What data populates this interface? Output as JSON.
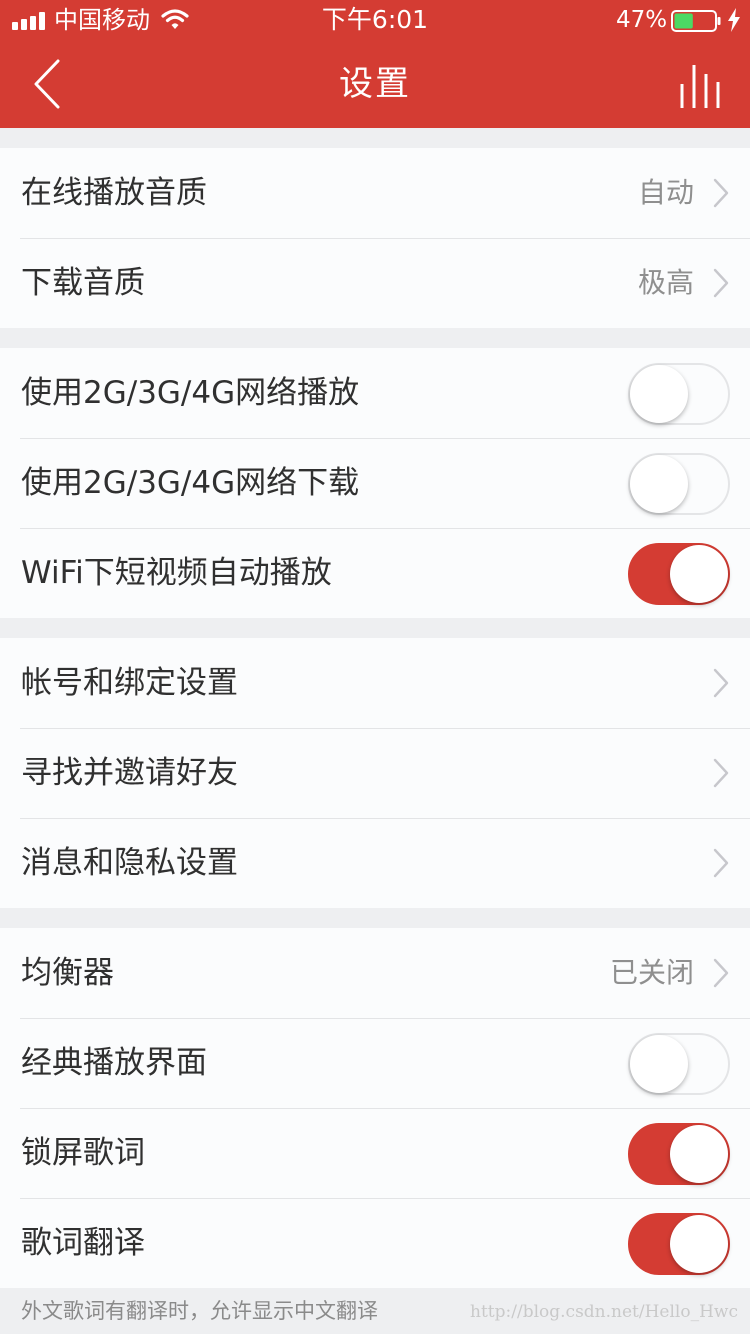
{
  "status_bar": {
    "carrier": "中国移动",
    "time": "下午6:01",
    "battery_percent": "47%",
    "battery_level": 0.47,
    "signal_bars": 4,
    "icons": [
      "signal-icon",
      "wifi-icon",
      "battery-icon",
      "charging-icon"
    ]
  },
  "header": {
    "title": "设置",
    "back_icon": "chevron-left-icon",
    "equalizer_icon": "equalizer-icon"
  },
  "groups": [
    {
      "rows": [
        {
          "label": "在线播放音质",
          "value": "自动",
          "type": "link"
        },
        {
          "label": "下载音质",
          "value": "极高",
          "type": "link"
        }
      ]
    },
    {
      "rows": [
        {
          "label": "使用2G/3G/4G网络播放",
          "type": "toggle",
          "on": false
        },
        {
          "label": "使用2G/3G/4G网络下载",
          "type": "toggle",
          "on": false
        },
        {
          "label": "WiFi下短视频自动播放",
          "type": "toggle",
          "on": true
        }
      ]
    },
    {
      "rows": [
        {
          "label": "帐号和绑定设置",
          "type": "link"
        },
        {
          "label": "寻找并邀请好友",
          "type": "link"
        },
        {
          "label": "消息和隐私设置",
          "type": "link"
        }
      ]
    },
    {
      "rows": [
        {
          "label": "均衡器",
          "value": "已关闭",
          "type": "link"
        },
        {
          "label": "经典播放界面",
          "type": "toggle",
          "on": false
        },
        {
          "label": "锁屏歌词",
          "type": "toggle",
          "on": true
        },
        {
          "label": "歌词翻译",
          "type": "toggle",
          "on": true
        }
      ]
    }
  ],
  "footer": {
    "note": "外文歌词有翻译时，允许显示中文翻译",
    "watermark": "http://blog.csdn.net/Hello_Hwc"
  },
  "colors": {
    "accent": "#d43c33",
    "background": "#eeeff1",
    "row_background": "#fbfcfd",
    "text": "#303030",
    "secondary_text": "#8f8f8f"
  }
}
